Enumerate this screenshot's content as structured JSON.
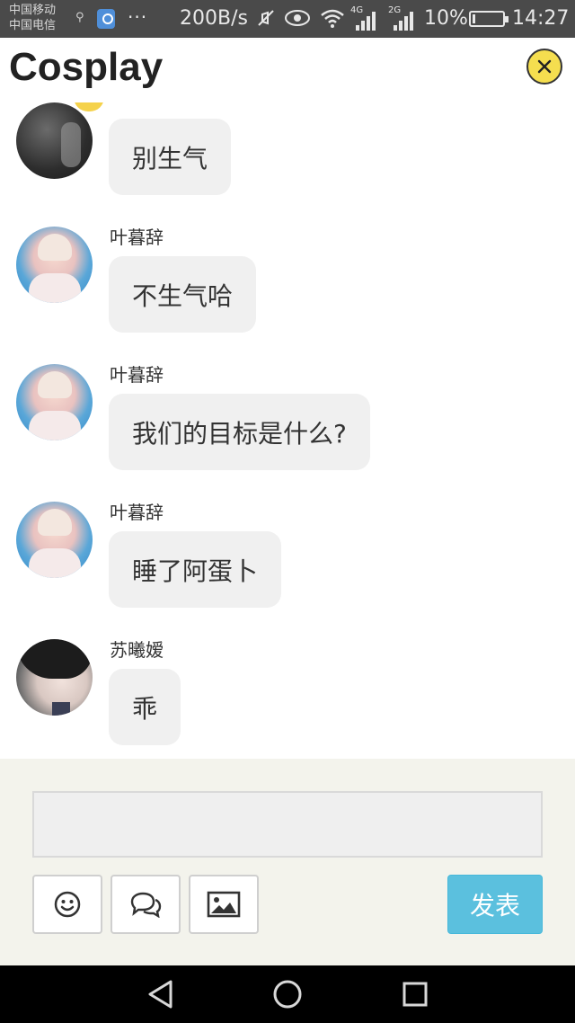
{
  "status_bar": {
    "carrier_1": "中国移动",
    "carrier_2": "中国电信",
    "more": "···",
    "net_speed": "200B/s",
    "signal_1_tag": "4G",
    "signal_2_tag": "2G",
    "battery_pct": "10%",
    "battery_level": 0.1,
    "time": "14:27"
  },
  "header": {
    "title": "Cosplay",
    "close_icon": "close-icon"
  },
  "messages": [
    {
      "sender": "",
      "text": "别生气",
      "avatar": "dark-photo"
    },
    {
      "sender": "叶暮辞",
      "text": "不生气哈",
      "avatar": "yejing-photo"
    },
    {
      "sender": "叶暮辞",
      "text": "我们的目标是什么?",
      "avatar": "yejing-photo"
    },
    {
      "sender": "叶暮辞",
      "text": "睡了阿蛋卜",
      "avatar": "yejing-photo"
    },
    {
      "sender": "苏曦嫒",
      "text": "乖",
      "avatar": "su-photo"
    }
  ],
  "composer": {
    "input_value": "",
    "emoji_icon": "smiley-icon",
    "chat_icon": "speech-bubbles-icon",
    "image_icon": "image-icon",
    "send_label": "发表"
  },
  "colors": {
    "send_button": "#5bc0de",
    "close_button": "#f5de4f",
    "bubble": "#f0f0f0"
  }
}
